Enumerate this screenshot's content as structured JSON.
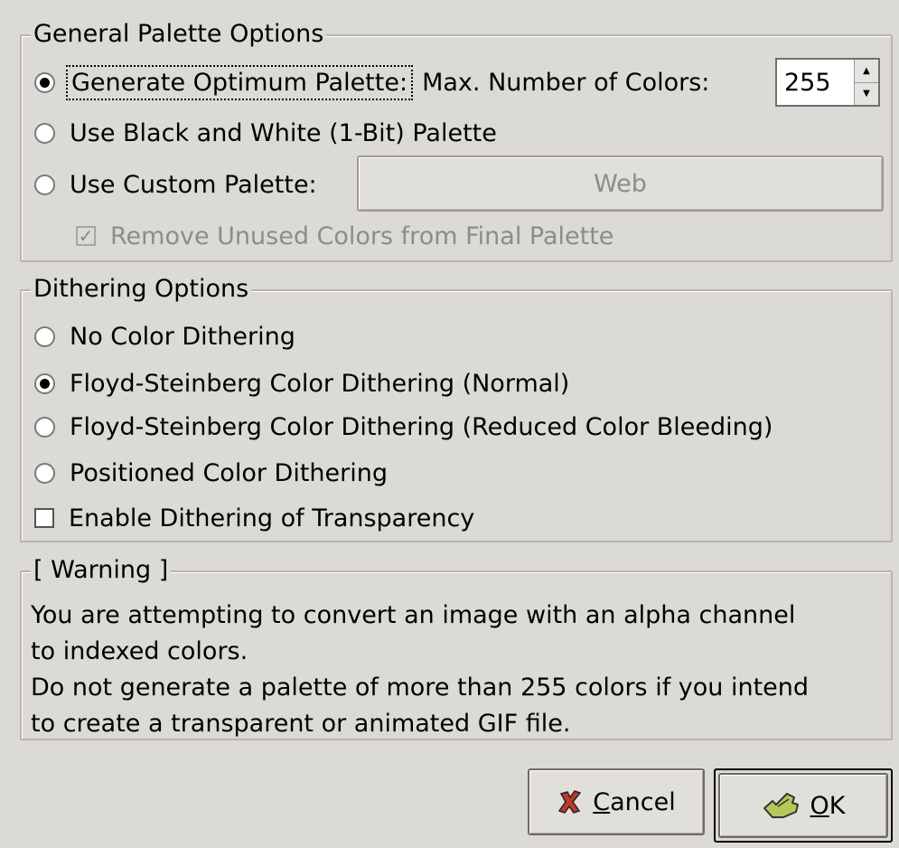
{
  "general": {
    "title": "General Palette Options",
    "optimum_label": "Generate Optimum Palette:",
    "max_colors_label": "Max. Number of Colors:",
    "max_colors_value": "255",
    "bw_label": "Use Black and White (1-Bit) Palette",
    "custom_label": "Use Custom Palette:",
    "custom_palette_value": "Web",
    "remove_unused_label": "Remove Unused Colors from Final Palette"
  },
  "dithering": {
    "title": "Dithering Options",
    "none_label": "No Color Dithering",
    "fs_normal_label": "Floyd-Steinberg Color Dithering (Normal)",
    "fs_reduced_label": "Floyd-Steinberg Color Dithering (Reduced Color Bleeding)",
    "positioned_label": "Positioned Color Dithering",
    "transparency_label": "Enable Dithering of Transparency"
  },
  "warning": {
    "title": "[ Warning ]",
    "lines": [
      "You are attempting to convert an image with an alpha channel",
      "to indexed colors.",
      "Do not generate a palette of more than 255 colors if you intend",
      "to create a transparent or animated GIF file."
    ]
  },
  "buttons": {
    "cancel_label": "Cancel",
    "ok_label": "OK"
  },
  "colors": {
    "background": "#dcdad5",
    "cancel_icon": "#c0392b",
    "ok_icon": "#6b8e23"
  },
  "icons": {
    "cancel": "cross-icon",
    "ok": "check-hand-icon"
  }
}
